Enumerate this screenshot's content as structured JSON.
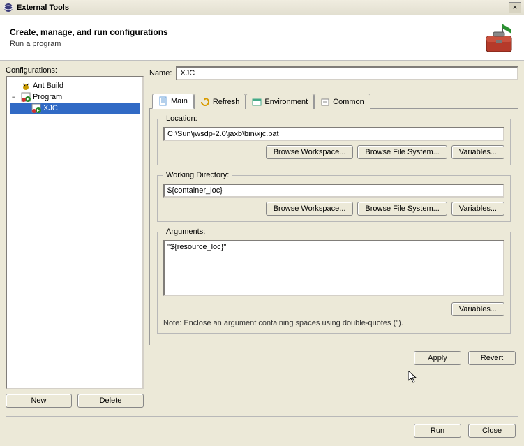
{
  "window": {
    "title": "External Tools",
    "close": "×"
  },
  "header": {
    "title": "Create, manage, and run configurations",
    "subtitle": "Run a program"
  },
  "leftPanel": {
    "label": "Configurations:",
    "tree": {
      "antBuild": "Ant Build",
      "program": "Program",
      "xjc": "XJC"
    },
    "newBtn": "New",
    "deleteBtn": "Delete"
  },
  "rightPanel": {
    "nameLabel": "Name:",
    "nameValue": "XJC",
    "tabs": {
      "main": "Main",
      "refresh": "Refresh",
      "environment": "Environment",
      "common": "Common"
    },
    "location": {
      "legend": "Location:",
      "value": "C:\\Sun\\jwsdp-2.0\\jaxb\\bin\\xjc.bat",
      "browseWorkspace": "Browse Workspace...",
      "browseFileSystem": "Browse File System...",
      "variables": "Variables..."
    },
    "workdir": {
      "legend": "Working Directory:",
      "value": "${container_loc}",
      "browseWorkspace": "Browse Workspace...",
      "browseFileSystem": "Browse File System...",
      "variables": "Variables..."
    },
    "args": {
      "legend": "Arguments:",
      "value": "\"${resource_loc}\"",
      "variables": "Variables...",
      "note": "Note: Enclose an argument containing spaces using double-quotes (\")."
    },
    "applyBtn": "Apply",
    "revertBtn": "Revert"
  },
  "footer": {
    "runBtn": "Run",
    "closeBtn": "Close"
  }
}
